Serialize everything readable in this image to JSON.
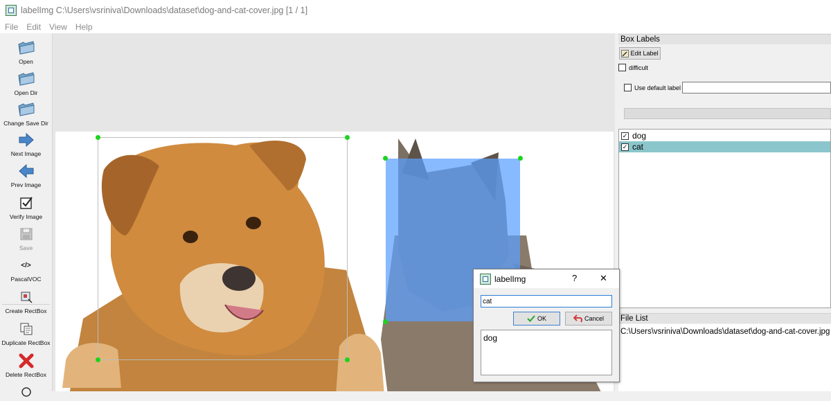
{
  "window": {
    "title": "labelImg C:\\Users\\vsriniva\\Downloads\\dataset\\dog-and-cat-cover.jpg [1 / 1]"
  },
  "menu": [
    "File",
    "Edit",
    "View",
    "Help"
  ],
  "toolbar": {
    "open": "Open",
    "open_dir": "Open Dir",
    "change_save_dir": "Change Save Dir",
    "next_image": "Next Image",
    "prev_image": "Prev Image",
    "verify_image": "Verify Image",
    "save": "Save",
    "format": "PascalVOC",
    "format_icon": "</>",
    "create_rectbox": "Create RectBox",
    "duplicate_rectbox": "Duplicate RectBox",
    "delete_rectbox": "Delete RectBox"
  },
  "box_labels": {
    "title": "Box Labels",
    "edit_label": "Edit Label",
    "difficult": "difficult",
    "use_default_label": "Use default label",
    "default_label_value": "",
    "items": [
      {
        "label": "dog",
        "checked": true,
        "selected": false
      },
      {
        "label": "cat",
        "checked": true,
        "selected": true
      }
    ]
  },
  "file_list": {
    "title": "File List",
    "items": [
      "C:\\Users\\vsriniva\\Downloads\\dataset\\dog-and-cat-cover.jpg"
    ]
  },
  "dialog": {
    "title": "labelImg",
    "help": "?",
    "close": "✕",
    "input_value": "cat",
    "ok": "OK",
    "cancel": "Cancel",
    "suggestions": [
      "dog"
    ]
  },
  "colors": {
    "selection_highlight": "#8ac6cb",
    "cat_box_fill": "#5aa0ff",
    "box_handle": "#1bd41b"
  }
}
